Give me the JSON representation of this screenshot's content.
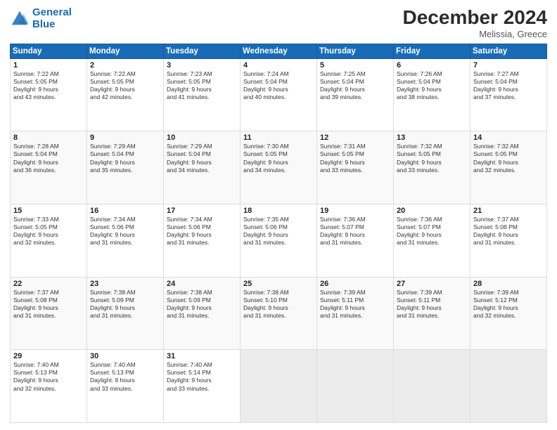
{
  "header": {
    "logo_line1": "General",
    "logo_line2": "Blue",
    "month": "December 2024",
    "location": "Melissia, Greece"
  },
  "weekdays": [
    "Sunday",
    "Monday",
    "Tuesday",
    "Wednesday",
    "Thursday",
    "Friday",
    "Saturday"
  ],
  "weeks": [
    [
      {
        "day": "1",
        "info": "Sunrise: 7:22 AM\nSunset: 5:05 PM\nDaylight: 9 hours\nand 43 minutes."
      },
      {
        "day": "2",
        "info": "Sunrise: 7:22 AM\nSunset: 5:05 PM\nDaylight: 9 hours\nand 42 minutes."
      },
      {
        "day": "3",
        "info": "Sunrise: 7:23 AM\nSunset: 5:05 PM\nDaylight: 9 hours\nand 41 minutes."
      },
      {
        "day": "4",
        "info": "Sunrise: 7:24 AM\nSunset: 5:04 PM\nDaylight: 9 hours\nand 40 minutes."
      },
      {
        "day": "5",
        "info": "Sunrise: 7:25 AM\nSunset: 5:04 PM\nDaylight: 9 hours\nand 39 minutes."
      },
      {
        "day": "6",
        "info": "Sunrise: 7:26 AM\nSunset: 5:04 PM\nDaylight: 9 hours\nand 38 minutes."
      },
      {
        "day": "7",
        "info": "Sunrise: 7:27 AM\nSunset: 5:04 PM\nDaylight: 9 hours\nand 37 minutes."
      }
    ],
    [
      {
        "day": "8",
        "info": "Sunrise: 7:28 AM\nSunset: 5:04 PM\nDaylight: 9 hours\nand 36 minutes."
      },
      {
        "day": "9",
        "info": "Sunrise: 7:29 AM\nSunset: 5:04 PM\nDaylight: 9 hours\nand 35 minutes."
      },
      {
        "day": "10",
        "info": "Sunrise: 7:29 AM\nSunset: 5:04 PM\nDaylight: 9 hours\nand 34 minutes."
      },
      {
        "day": "11",
        "info": "Sunrise: 7:30 AM\nSunset: 5:05 PM\nDaylight: 9 hours\nand 34 minutes."
      },
      {
        "day": "12",
        "info": "Sunrise: 7:31 AM\nSunset: 5:05 PM\nDaylight: 9 hours\nand 33 minutes."
      },
      {
        "day": "13",
        "info": "Sunrise: 7:32 AM\nSunset: 5:05 PM\nDaylight: 9 hours\nand 33 minutes."
      },
      {
        "day": "14",
        "info": "Sunrise: 7:32 AM\nSunset: 5:05 PM\nDaylight: 9 hours\nand 32 minutes."
      }
    ],
    [
      {
        "day": "15",
        "info": "Sunrise: 7:33 AM\nSunset: 5:05 PM\nDaylight: 9 hours\nand 32 minutes."
      },
      {
        "day": "16",
        "info": "Sunrise: 7:34 AM\nSunset: 5:06 PM\nDaylight: 9 hours\nand 31 minutes."
      },
      {
        "day": "17",
        "info": "Sunrise: 7:34 AM\nSunset: 5:06 PM\nDaylight: 9 hours\nand 31 minutes."
      },
      {
        "day": "18",
        "info": "Sunrise: 7:35 AM\nSunset: 5:06 PM\nDaylight: 9 hours\nand 31 minutes."
      },
      {
        "day": "19",
        "info": "Sunrise: 7:36 AM\nSunset: 5:07 PM\nDaylight: 9 hours\nand 31 minutes."
      },
      {
        "day": "20",
        "info": "Sunrise: 7:36 AM\nSunset: 5:07 PM\nDaylight: 9 hours\nand 31 minutes."
      },
      {
        "day": "21",
        "info": "Sunrise: 7:37 AM\nSunset: 5:08 PM\nDaylight: 9 hours\nand 31 minutes."
      }
    ],
    [
      {
        "day": "22",
        "info": "Sunrise: 7:37 AM\nSunset: 5:08 PM\nDaylight: 9 hours\nand 31 minutes."
      },
      {
        "day": "23",
        "info": "Sunrise: 7:38 AM\nSunset: 5:09 PM\nDaylight: 9 hours\nand 31 minutes."
      },
      {
        "day": "24",
        "info": "Sunrise: 7:38 AM\nSunset: 5:09 PM\nDaylight: 9 hours\nand 31 minutes."
      },
      {
        "day": "25",
        "info": "Sunrise: 7:38 AM\nSunset: 5:10 PM\nDaylight: 9 hours\nand 31 minutes."
      },
      {
        "day": "26",
        "info": "Sunrise: 7:39 AM\nSunset: 5:11 PM\nDaylight: 9 hours\nand 31 minutes."
      },
      {
        "day": "27",
        "info": "Sunrise: 7:39 AM\nSunset: 5:11 PM\nDaylight: 9 hours\nand 31 minutes."
      },
      {
        "day": "28",
        "info": "Sunrise: 7:39 AM\nSunset: 5:12 PM\nDaylight: 9 hours\nand 32 minutes."
      }
    ],
    [
      {
        "day": "29",
        "info": "Sunrise: 7:40 AM\nSunset: 5:13 PM\nDaylight: 9 hours\nand 32 minutes."
      },
      {
        "day": "30",
        "info": "Sunrise: 7:40 AM\nSunset: 5:13 PM\nDaylight: 9 hours\nand 33 minutes."
      },
      {
        "day": "31",
        "info": "Sunrise: 7:40 AM\nSunset: 5:14 PM\nDaylight: 9 hours\nand 33 minutes."
      },
      null,
      null,
      null,
      null
    ]
  ]
}
